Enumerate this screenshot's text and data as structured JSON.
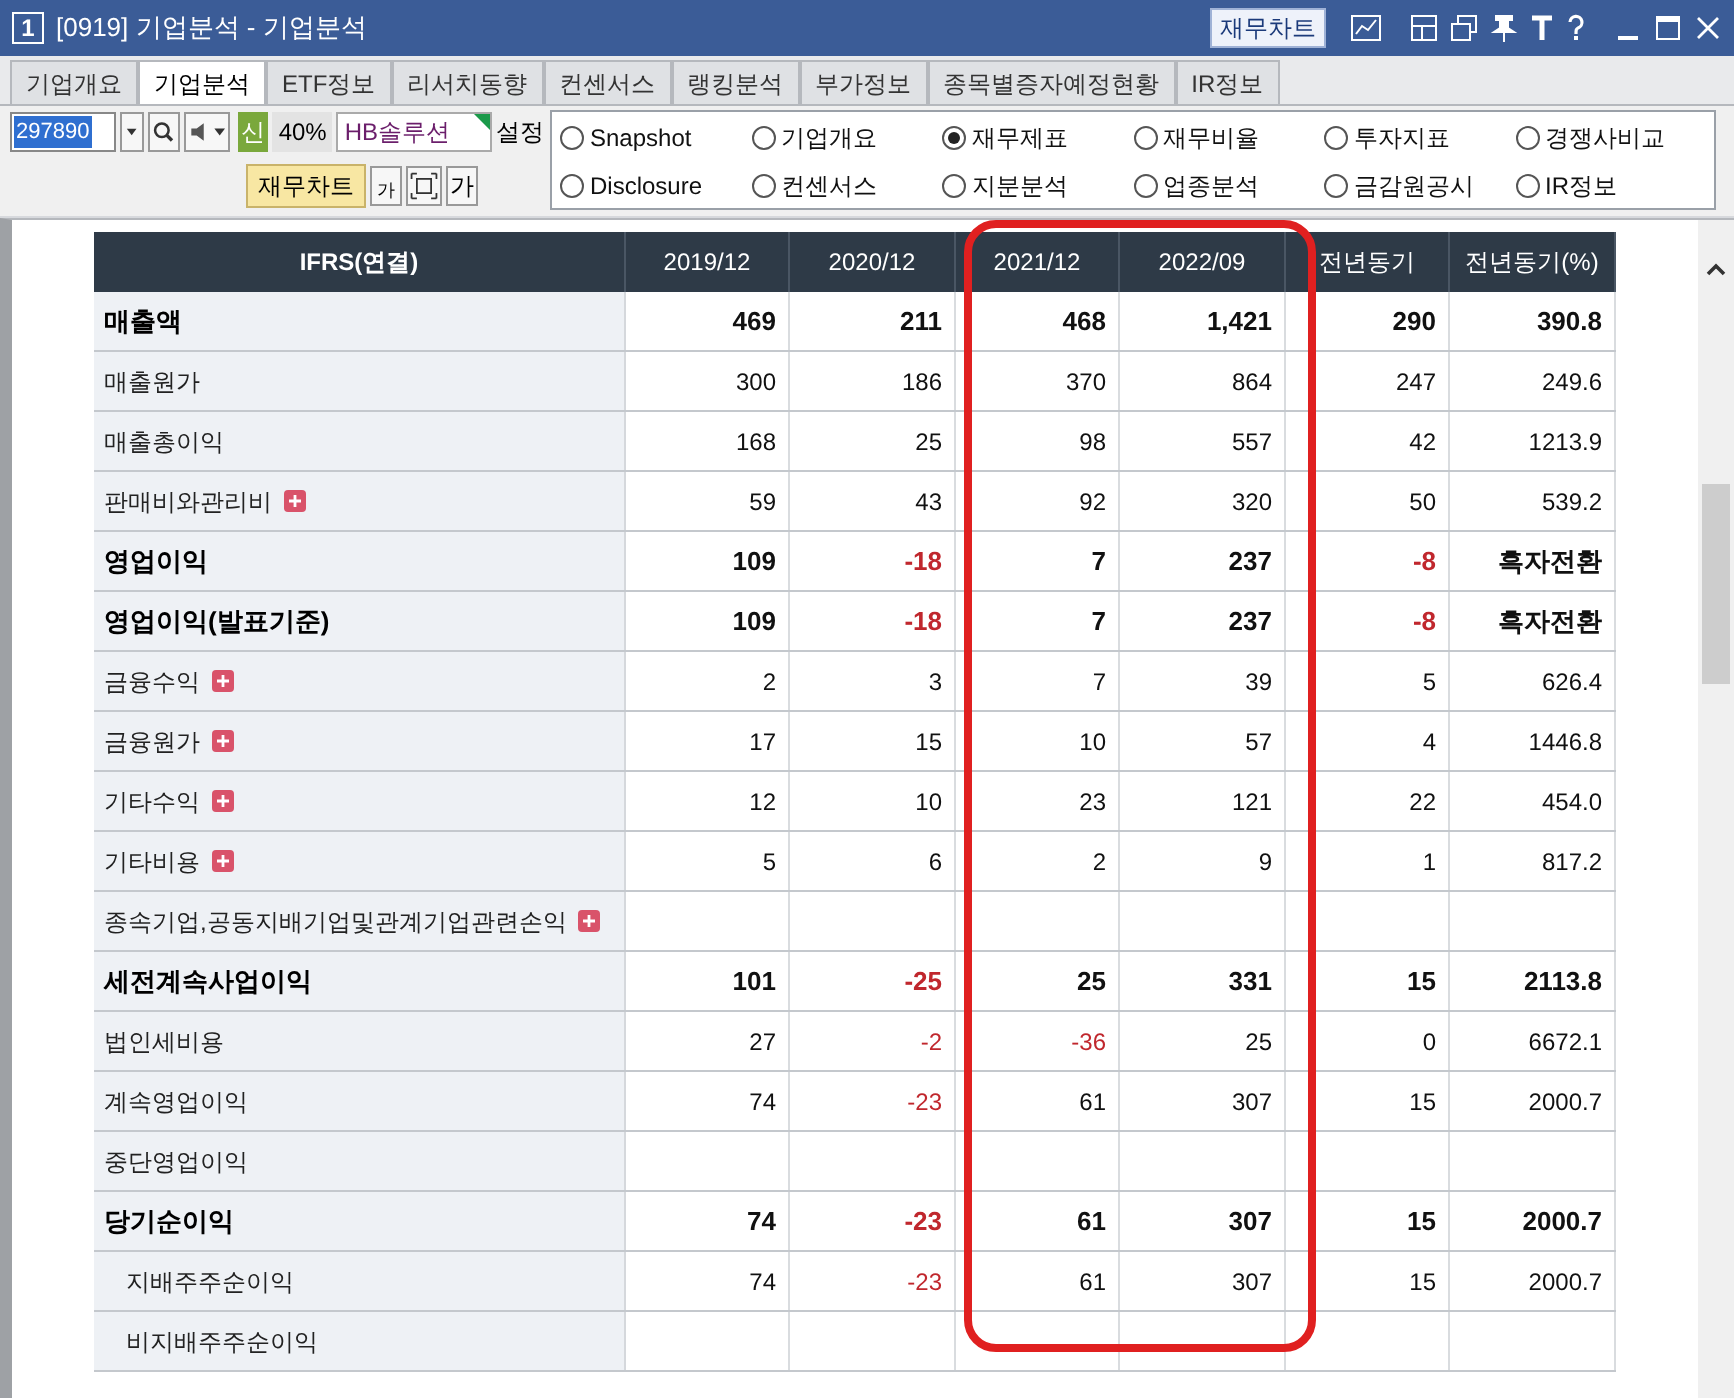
{
  "window": {
    "number": "1",
    "title": "[0919] 기업분석 - 기업분석",
    "chart_button": "재무차트"
  },
  "tabs": [
    {
      "label": "기업개요",
      "selected": false
    },
    {
      "label": "기업분석",
      "selected": true
    },
    {
      "label": "ETF정보",
      "selected": false
    },
    {
      "label": "리서치동향",
      "selected": false
    },
    {
      "label": "컨센서스",
      "selected": false
    },
    {
      "label": "랭킹분석",
      "selected": false
    },
    {
      "label": "부가정보",
      "selected": false
    },
    {
      "label": "종목별증자예정현황",
      "selected": false
    },
    {
      "label": "IR정보",
      "selected": false
    }
  ],
  "toolbar": {
    "code": "297890",
    "badge": "신",
    "ratio": "40%",
    "name": "HB솔루션",
    "settings": "설정",
    "chart_button": "재무차트",
    "font_small": "가",
    "font_large": "가"
  },
  "views": [
    {
      "label": "Snapshot",
      "selected": false
    },
    {
      "label": "기업개요",
      "selected": false
    },
    {
      "label": "재무제표",
      "selected": true
    },
    {
      "label": "재무비율",
      "selected": false
    },
    {
      "label": "투자지표",
      "selected": false
    },
    {
      "label": "경쟁사비교",
      "selected": false
    },
    {
      "label": "Disclosure",
      "selected": false
    },
    {
      "label": "컨센서스",
      "selected": false
    },
    {
      "label": "지분분석",
      "selected": false
    },
    {
      "label": "업종분석",
      "selected": false
    },
    {
      "label": "금감원공시",
      "selected": false
    },
    {
      "label": "IR정보",
      "selected": false
    }
  ],
  "table": {
    "columns": [
      "IFRS(연결)",
      "2019/12",
      "2020/12",
      "2021/12",
      "2022/09",
      "전년동기",
      "전년동기(%)"
    ],
    "rows": [
      {
        "label": "매출액",
        "kind": "total",
        "expandable": false,
        "values": [
          {
            "text": "469",
            "negative": false
          },
          {
            "text": "211",
            "negative": false
          },
          {
            "text": "468",
            "negative": false
          },
          {
            "text": "1,421",
            "negative": false
          },
          {
            "text": "290",
            "negative": false
          },
          {
            "text": "390.8",
            "negative": false
          }
        ]
      },
      {
        "label": "매출원가",
        "kind": "item",
        "expandable": false,
        "values": [
          {
            "text": "300",
            "negative": false
          },
          {
            "text": "186",
            "negative": false
          },
          {
            "text": "370",
            "negative": false
          },
          {
            "text": "864",
            "negative": false
          },
          {
            "text": "247",
            "negative": false
          },
          {
            "text": "249.6",
            "negative": false
          }
        ]
      },
      {
        "label": "매출총이익",
        "kind": "item",
        "expandable": false,
        "values": [
          {
            "text": "168",
            "negative": false
          },
          {
            "text": "25",
            "negative": false
          },
          {
            "text": "98",
            "negative": false
          },
          {
            "text": "557",
            "negative": false
          },
          {
            "text": "42",
            "negative": false
          },
          {
            "text": "1213.9",
            "negative": false
          }
        ]
      },
      {
        "label": "판매비와관리비",
        "kind": "item",
        "expandable": true,
        "values": [
          {
            "text": "59",
            "negative": false
          },
          {
            "text": "43",
            "negative": false
          },
          {
            "text": "92",
            "negative": false
          },
          {
            "text": "320",
            "negative": false
          },
          {
            "text": "50",
            "negative": false
          },
          {
            "text": "539.2",
            "negative": false
          }
        ]
      },
      {
        "label": "영업이익",
        "kind": "total",
        "expandable": false,
        "values": [
          {
            "text": "109",
            "negative": false
          },
          {
            "text": "-18",
            "negative": true
          },
          {
            "text": "7",
            "negative": false
          },
          {
            "text": "237",
            "negative": false
          },
          {
            "text": "-8",
            "negative": true
          },
          {
            "text": "흑자전환",
            "negative": false
          }
        ]
      },
      {
        "label": "영업이익(발표기준)",
        "kind": "total",
        "expandable": false,
        "values": [
          {
            "text": "109",
            "negative": false
          },
          {
            "text": "-18",
            "negative": true
          },
          {
            "text": "7",
            "negative": false
          },
          {
            "text": "237",
            "negative": false
          },
          {
            "text": "-8",
            "negative": true
          },
          {
            "text": "흑자전환",
            "negative": false
          }
        ]
      },
      {
        "label": "금융수익",
        "kind": "item",
        "expandable": true,
        "values": [
          {
            "text": "2",
            "negative": false
          },
          {
            "text": "3",
            "negative": false
          },
          {
            "text": "7",
            "negative": false
          },
          {
            "text": "39",
            "negative": false
          },
          {
            "text": "5",
            "negative": false
          },
          {
            "text": "626.4",
            "negative": false
          }
        ]
      },
      {
        "label": "금융원가",
        "kind": "item",
        "expandable": true,
        "values": [
          {
            "text": "17",
            "negative": false
          },
          {
            "text": "15",
            "negative": false
          },
          {
            "text": "10",
            "negative": false
          },
          {
            "text": "57",
            "negative": false
          },
          {
            "text": "4",
            "negative": false
          },
          {
            "text": "1446.8",
            "negative": false
          }
        ]
      },
      {
        "label": "기타수익",
        "kind": "item",
        "expandable": true,
        "values": [
          {
            "text": "12",
            "negative": false
          },
          {
            "text": "10",
            "negative": false
          },
          {
            "text": "23",
            "negative": false
          },
          {
            "text": "121",
            "negative": false
          },
          {
            "text": "22",
            "negative": false
          },
          {
            "text": "454.0",
            "negative": false
          }
        ]
      },
      {
        "label": "기타비용",
        "kind": "item",
        "expandable": true,
        "values": [
          {
            "text": "5",
            "negative": false
          },
          {
            "text": "6",
            "negative": false
          },
          {
            "text": "2",
            "negative": false
          },
          {
            "text": "9",
            "negative": false
          },
          {
            "text": "1",
            "negative": false
          },
          {
            "text": "817.2",
            "negative": false
          }
        ]
      },
      {
        "label": "종속기업,공동지배기업및관계기업관련손익",
        "kind": "item",
        "expandable": true
      },
      {
        "label": "세전계속사업이익",
        "kind": "total",
        "expandable": false,
        "values": [
          {
            "text": "101",
            "negative": false
          },
          {
            "text": "-25",
            "negative": true
          },
          {
            "text": "25",
            "negative": false
          },
          {
            "text": "331",
            "negative": false
          },
          {
            "text": "15",
            "negative": false
          },
          {
            "text": "2113.8",
            "negative": false
          }
        ]
      },
      {
        "label": "법인세비용",
        "kind": "item",
        "expandable": false,
        "values": [
          {
            "text": "27",
            "negative": false
          },
          {
            "text": "-2",
            "negative": true
          },
          {
            "text": "-36",
            "negative": true
          },
          {
            "text": "25",
            "negative": false
          },
          {
            "text": "0",
            "negative": false
          },
          {
            "text": "6672.1",
            "negative": false
          }
        ]
      },
      {
        "label": "계속영업이익",
        "kind": "item",
        "expandable": false,
        "values": [
          {
            "text": "74",
            "negative": false
          },
          {
            "text": "-23",
            "negative": true
          },
          {
            "text": "61",
            "negative": false
          },
          {
            "text": "307",
            "negative": false
          },
          {
            "text": "15",
            "negative": false
          },
          {
            "text": "2000.7",
            "negative": false
          }
        ]
      },
      {
        "label": "중단영업이익",
        "kind": "item",
        "expandable": false
      },
      {
        "label": "당기순이익",
        "kind": "total",
        "expandable": false,
        "values": [
          {
            "text": "74",
            "negative": false
          },
          {
            "text": "-23",
            "negative": true
          },
          {
            "text": "61",
            "negative": false
          },
          {
            "text": "307",
            "negative": false
          },
          {
            "text": "15",
            "negative": false
          },
          {
            "text": "2000.7",
            "negative": false
          }
        ],
        "children": [
          {
            "label": "지배주주순이익",
            "expandable": false,
            "values": [
              {
                "text": "74",
                "negative": false
              },
              {
                "text": "-23",
                "negative": true
              },
              {
                "text": "61",
                "negative": false
              },
              {
                "text": "307",
                "negative": false
              },
              {
                "text": "15",
                "negative": false
              },
              {
                "text": "2000.7",
                "negative": false
              }
            ]
          },
          {
            "label": "비지배주주순이익",
            "expandable": false
          }
        ]
      }
    ]
  }
}
